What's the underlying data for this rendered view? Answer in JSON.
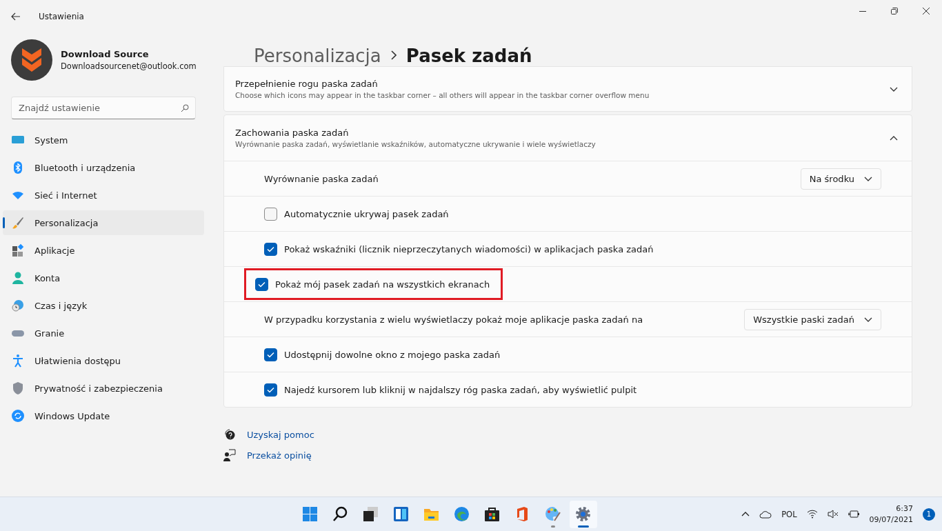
{
  "window": {
    "title": "Ustawienia"
  },
  "profile": {
    "name": "Download Source",
    "email": "Downloadsourcenet@outlook.com"
  },
  "search": {
    "placeholder": "Znajdź ustawienie"
  },
  "sidebar": {
    "items": [
      {
        "label": "System",
        "selected": false
      },
      {
        "label": "Bluetooth i urządzenia",
        "selected": false
      },
      {
        "label": "Sieć i Internet",
        "selected": false
      },
      {
        "label": "Personalizacja",
        "selected": true
      },
      {
        "label": "Aplikacje",
        "selected": false
      },
      {
        "label": "Konta",
        "selected": false
      },
      {
        "label": "Czas i język",
        "selected": false
      },
      {
        "label": "Granie",
        "selected": false
      },
      {
        "label": "Ułatwienia dostępu",
        "selected": false
      },
      {
        "label": "Prywatność i zabezpieczenia",
        "selected": false
      },
      {
        "label": "Windows Update",
        "selected": false
      }
    ]
  },
  "breadcrumb": {
    "parent": "Personalizacja",
    "current": "Pasek zadań"
  },
  "sections": [
    {
      "title": "Przepełnienie rogu paska zadań",
      "description": "Choose which icons may appear in the taskbar corner – all others will appear in the taskbar corner overflow menu",
      "expanded": false
    },
    {
      "title": "Zachowania paska zadań",
      "description": "Wyrównanie paska zadań, wyświetlanie wskaźników, automatyczne ukrywanie i wiele wyświetlaczy",
      "expanded": true,
      "rows": [
        {
          "kind": "dropdown",
          "label": "Wyrównanie paska zadań",
          "value": "Na środku",
          "highlighted": false
        },
        {
          "kind": "checkbox",
          "label": "Automatycznie ukrywaj pasek zadań",
          "checked": false,
          "highlighted": false
        },
        {
          "kind": "checkbox",
          "label": "Pokaż wskaźniki (licznik nieprzeczytanych wiadomości) w aplikacjach paska zadań",
          "checked": true,
          "highlighted": false
        },
        {
          "kind": "checkbox",
          "label": "Pokaż mój pasek zadań na wszystkich ekranach",
          "checked": true,
          "highlighted": true
        },
        {
          "kind": "dropdown",
          "label": "W przypadku korzystania z wielu wyświetlaczy pokaż moje aplikacje paska zadań na",
          "value": "Wszystkie paski zadań",
          "highlighted": false
        },
        {
          "kind": "checkbox",
          "label": "Udostępnij dowolne okno z mojego paska zadań",
          "checked": true,
          "highlighted": false
        },
        {
          "kind": "checkbox",
          "label": "Najedź kursorem lub kliknij w najdalszy róg paska zadań, aby wyświetlić pulpit",
          "checked": true,
          "highlighted": false
        }
      ]
    }
  ],
  "links": [
    {
      "label": "Uzyskaj pomoc"
    },
    {
      "label": "Przekaż opinię"
    }
  ],
  "taskbar": {
    "apps": [
      {
        "open": false,
        "selected": false
      },
      {
        "open": false,
        "selected": false
      },
      {
        "open": false,
        "selected": false
      },
      {
        "open": false,
        "selected": false
      },
      {
        "open": false,
        "selected": false
      },
      {
        "open": false,
        "selected": false
      },
      {
        "open": false,
        "selected": false
      },
      {
        "open": false,
        "selected": false
      },
      {
        "open": true,
        "selected": false
      },
      {
        "open": true,
        "selected": true
      }
    ],
    "language": "POL",
    "time": "6:37",
    "date": "09/07/2021",
    "notifications": "1"
  }
}
